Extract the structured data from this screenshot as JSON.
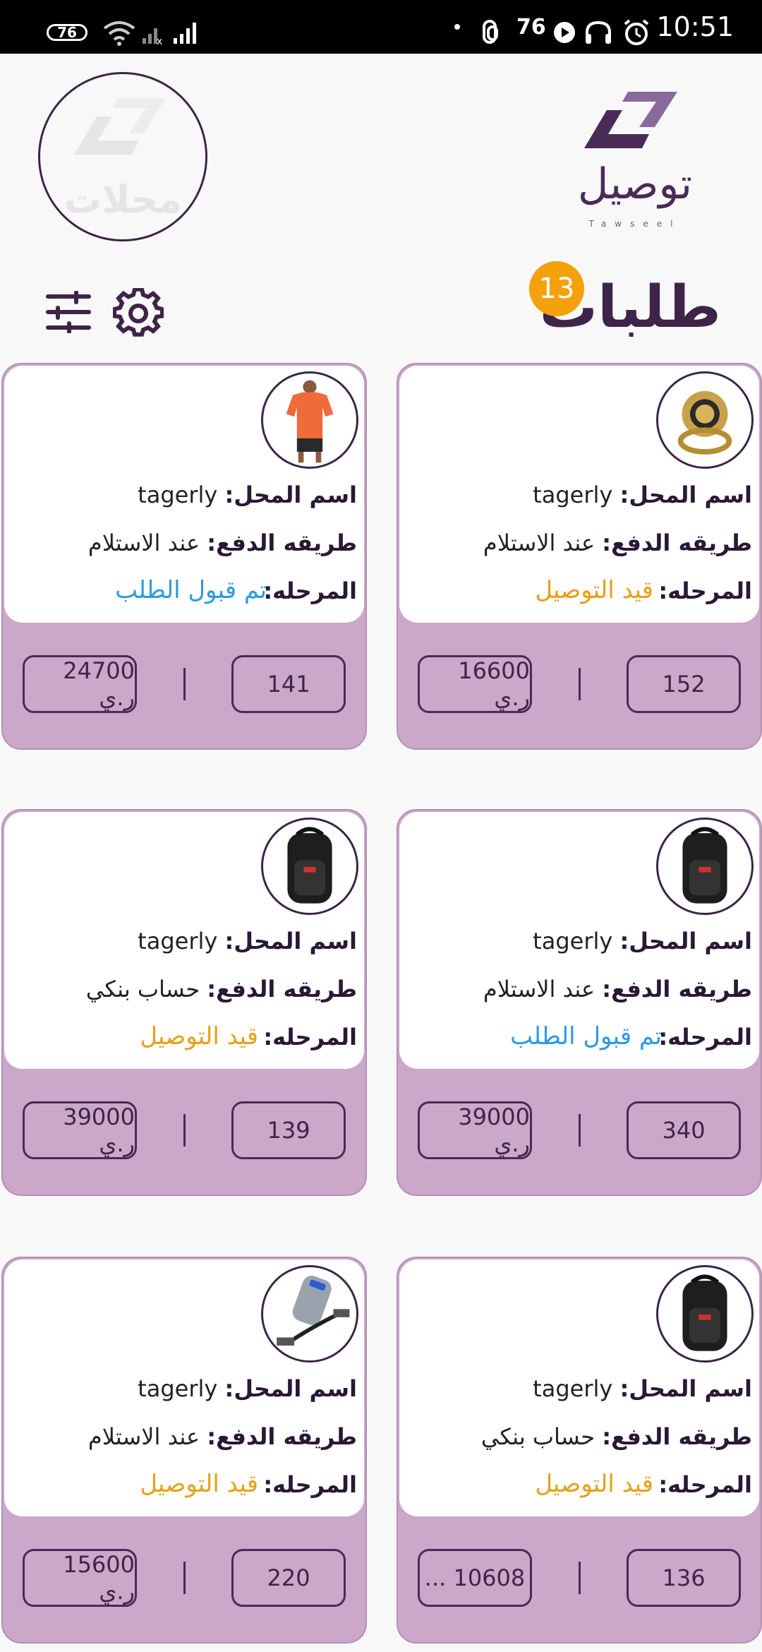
{
  "status_bar": {
    "battery_left": "76",
    "battery_right": "76",
    "time": "10:51"
  },
  "header": {
    "app_name": "توصيل",
    "app_sub": "Tawseel",
    "store_watermark": "محلات",
    "title": "طلبات",
    "count": "13"
  },
  "icons": {
    "settings": "gear-icon",
    "filters": "sliders-icon"
  },
  "labels": {
    "shop_name": "اسم المحل:",
    "payment": "طريقه الدفع:",
    "stage": "المرحله:"
  },
  "orders": [
    {
      "shop": "tagerly",
      "payment": "عند الاستلام",
      "stage": "قيد التوصيل",
      "stage_color": "orange",
      "id": "152",
      "price": "16600 ر.ي",
      "image": "ring"
    },
    {
      "shop": "tagerly",
      "payment": "عند الاستلام",
      "stage": "تم قبول الطلب",
      "stage_color": "blue",
      "id": "141",
      "price": "24700 ر.ي",
      "image": "tshirt"
    },
    {
      "shop": "tagerly",
      "payment": "عند الاستلام",
      "stage": "تم قبول الطلب",
      "stage_color": "blue",
      "id": "340",
      "price": "39000 ر.ي",
      "image": "backpack"
    },
    {
      "shop": "tagerly",
      "payment": "حساب بنكي",
      "stage": "قيد التوصيل",
      "stage_color": "orange",
      "id": "139",
      "price": "39000 ر.ي",
      "image": "backpack"
    },
    {
      "shop": "tagerly",
      "payment": "حساب بنكي",
      "stage": "قيد التوصيل",
      "stage_color": "orange",
      "id": "136",
      "price": "10608 ...",
      "image": "backpack"
    },
    {
      "shop": "tagerly",
      "payment": "عند الاستلام",
      "stage": "قيد التوصيل",
      "stage_color": "orange",
      "id": "220",
      "price": "15600 ر.ي",
      "image": "charger"
    }
  ]
}
